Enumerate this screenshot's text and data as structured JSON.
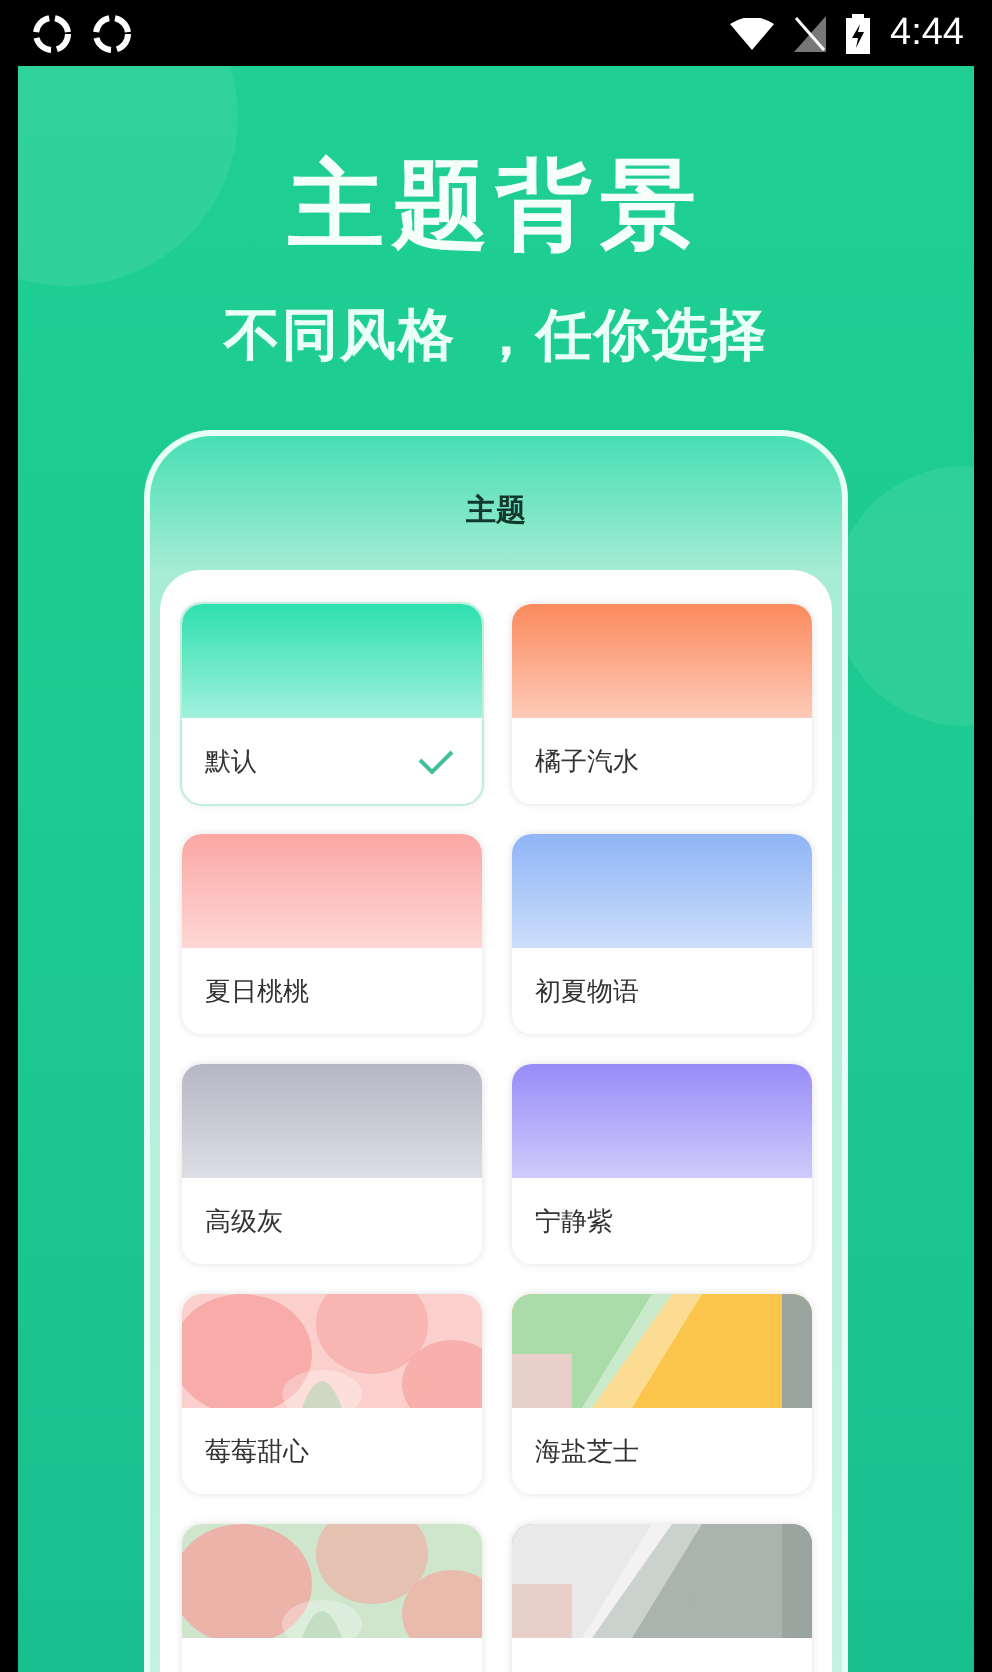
{
  "status_bar": {
    "time": "4:44"
  },
  "header": {
    "title": "主题背景",
    "subtitle": "不同风格 ，任你选择"
  },
  "phone": {
    "title": "主题",
    "themes": [
      {
        "name": "默认",
        "selected": true,
        "kind": "gradient",
        "color": "#2fe0b0"
      },
      {
        "name": "橘子汽水",
        "selected": false,
        "kind": "gradient",
        "color": "#fb8a5e"
      },
      {
        "name": "夏日桃桃",
        "selected": false,
        "kind": "gradient",
        "color": "#fba7a4"
      },
      {
        "name": "初夏物语",
        "selected": false,
        "kind": "gradient",
        "color": "#8fb5f6"
      },
      {
        "name": "高级灰",
        "selected": false,
        "kind": "gradient",
        "color": "#b6b6c6"
      },
      {
        "name": "宁静紫",
        "selected": false,
        "kind": "gradient",
        "color": "#978cf8"
      },
      {
        "name": "莓莓甜心",
        "selected": false,
        "kind": "picture"
      },
      {
        "name": "海盐芝士",
        "selected": false,
        "kind": "picture"
      },
      {
        "selected": false,
        "kind": "picture"
      },
      {
        "selected": false,
        "kind": "picture"
      }
    ]
  }
}
